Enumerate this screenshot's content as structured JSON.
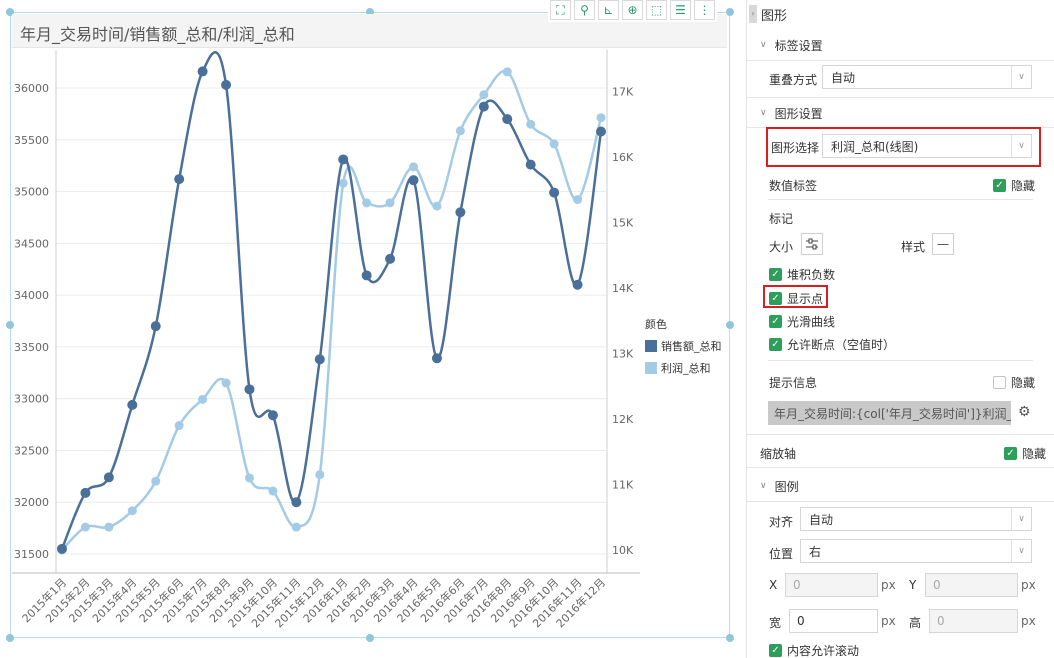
{
  "chart": {
    "title": "年月_交易时间/销售额_总和/利润_总和",
    "legend_title": "颜色",
    "toolbar": [
      "expand-icon",
      "filter-icon",
      "chart-icon",
      "zoom-icon",
      "select-icon",
      "list-icon",
      "more-icon"
    ],
    "toolbar_glyphs": [
      "⛶",
      "⚲",
      "⊾",
      "⊕",
      "⬚",
      "☰",
      "⋮"
    ]
  },
  "chart_data": {
    "type": "line",
    "categories": [
      "2015年1月",
      "2015年2月",
      "2015年3月",
      "2015年4月",
      "2015年5月",
      "2015年6月",
      "2015年7月",
      "2015年8月",
      "2015年9月",
      "2015年10月",
      "2015年11月",
      "2015年12月",
      "2016年1月",
      "2016年2月",
      "2016年3月",
      "2016年4月",
      "2016年5月",
      "2016年6月",
      "2016年7月",
      "2016年8月",
      "2016年9月",
      "2016年10月",
      "2016年11月",
      "2016年12月"
    ],
    "series": [
      {
        "name": "销售额_总和",
        "axis": "left",
        "color": "#4a6f98",
        "values": [
          31550,
          32090,
          32240,
          32940,
          33700,
          35120,
          36160,
          36030,
          33090,
          32840,
          32000,
          33380,
          35310,
          34190,
          34350,
          35110,
          33390,
          34800,
          35820,
          35700,
          35260,
          34990,
          34100,
          35580
        ]
      },
      {
        "name": "利润_总和",
        "axis": "right",
        "color": "#a3cbe5",
        "values": [
          10000,
          10350,
          10350,
          10600,
          11050,
          11900,
          12300,
          12550,
          11100,
          10900,
          10350,
          11150,
          15600,
          15300,
          15300,
          15850,
          15250,
          16400,
          16950,
          17300,
          16500,
          16200,
          15350,
          16600
        ]
      }
    ],
    "y_left": {
      "ticks": [
        31500,
        32000,
        32500,
        33000,
        33500,
        34000,
        34500,
        35000,
        35500,
        36000
      ],
      "labels": [
        "31500",
        "32000",
        "32500",
        "33000",
        "33500",
        "34000",
        "34500",
        "35000",
        "35500",
        "36000"
      ]
    },
    "y_right": {
      "ticks": [
        10000,
        11000,
        12000,
        13000,
        14000,
        15000,
        16000,
        17000
      ],
      "labels": [
        "10K",
        "11K",
        "12K",
        "13K",
        "14K",
        "15K",
        "16K",
        "17K"
      ]
    },
    "grid": true,
    "legend": "right"
  },
  "panel": {
    "title": "图形",
    "label_settings": "标签设置",
    "overlap_label": "重叠方式",
    "overlap_value": "自动",
    "shape_settings": "图形设置",
    "shape_select_label": "图形选择",
    "shape_select_value": "利润_总和(线图)",
    "value_label": "数值标签",
    "hide": "隐藏",
    "marker": "标记",
    "size": "大小",
    "style": "样式",
    "style_glyph": "—",
    "stack_negative": "堆积负数",
    "show_points": "显示点",
    "smooth_curve": "光滑曲线",
    "allow_break": "允许断点（空值时）",
    "tooltip_info": "提示信息",
    "tooltip_value": "年月_交易时间:{col['年月_交易时间']}利润_总和:...",
    "zoom_axis": "缩放轴",
    "legend_section": "图例",
    "align_label": "对齐",
    "align_value": "自动",
    "position_label": "位置",
    "position_value": "右",
    "x_label": "X",
    "x_value": "0",
    "y_label": "Y",
    "y_value": "0",
    "width_label": "宽",
    "width_value": "0",
    "height_label": "高",
    "height_value": "0",
    "unit": "px",
    "scroll_label": "内容允许滚动"
  }
}
